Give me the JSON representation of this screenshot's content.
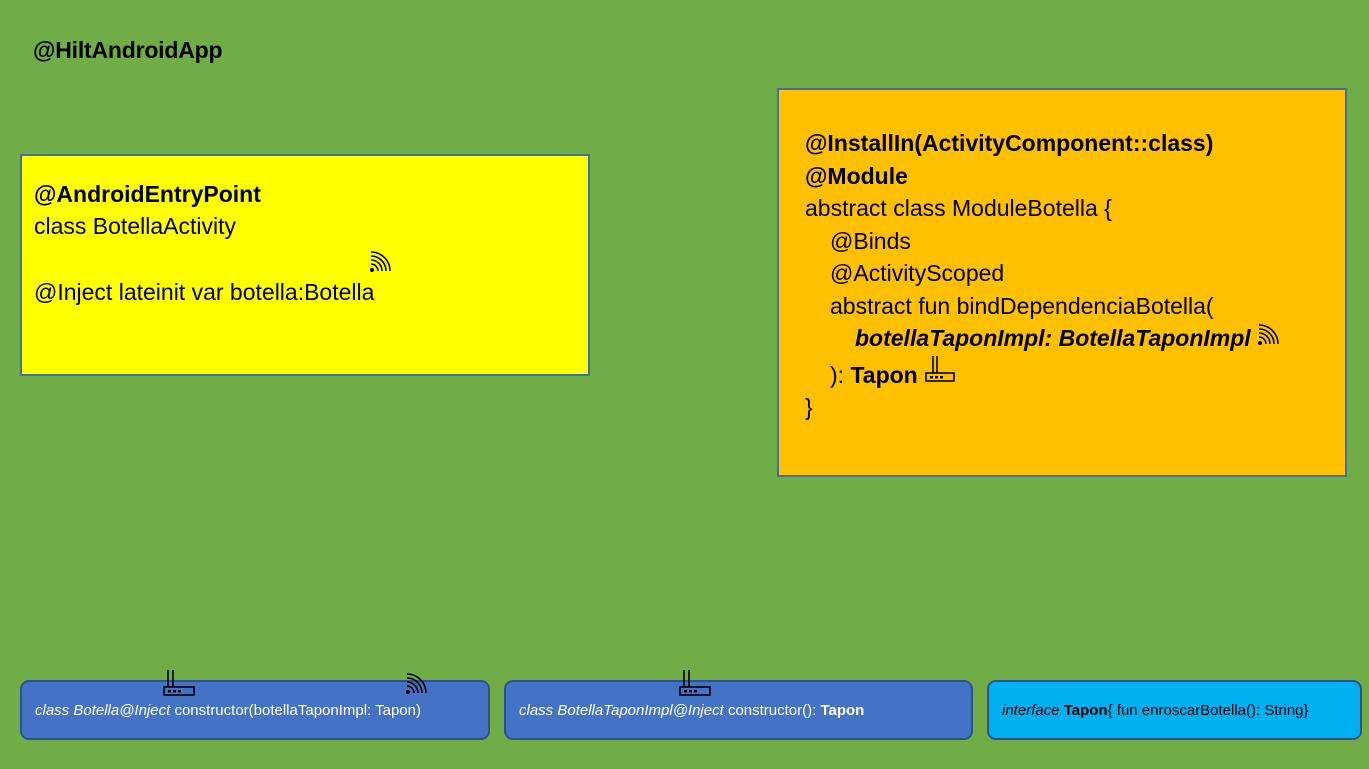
{
  "app_annotation": "@HiltAndroidApp",
  "activity": {
    "annotation": "@AndroidEntryPoint",
    "class_line": "class BotellaActivity",
    "inject_line": "@Inject lateinit var botella:Botella"
  },
  "module": {
    "install_in": "@InstallIn(ActivityComponent::class)",
    "module_annotation": "@Module",
    "class_line": "abstract class ModuleBotella {",
    "binds": "@Binds",
    "scoped": "@ActivityScoped",
    "fun_line": "abstract fun bindDependenciaBotella(",
    "param": "botellaTaponImpl: BotellaTaponImpl",
    "return_prefix": "): ",
    "return_type": "Tapon",
    "close": "}"
  },
  "classes": {
    "botella": {
      "decl": "class Botella@Inject",
      "rest": " constructor(botellaTaponImpl: Tapon)"
    },
    "botella_tapon_impl": {
      "decl": "class BotellaTaponImpl@Inject",
      "rest": " constructor(): ",
      "type": "Tapon"
    },
    "tapon": {
      "keyword": "interface",
      "name": " Tapon",
      "rest": "{ fun enroscarBotella(): String}"
    }
  },
  "icons": [
    "wifi-signal-icon",
    "router-icon"
  ],
  "colors": {
    "background": "#70ad47",
    "activity_box": "#ffff00",
    "module_box": "#ffc000",
    "class_box": "#4472c4",
    "interface_box": "#00b0f0",
    "border": "#41719c"
  }
}
